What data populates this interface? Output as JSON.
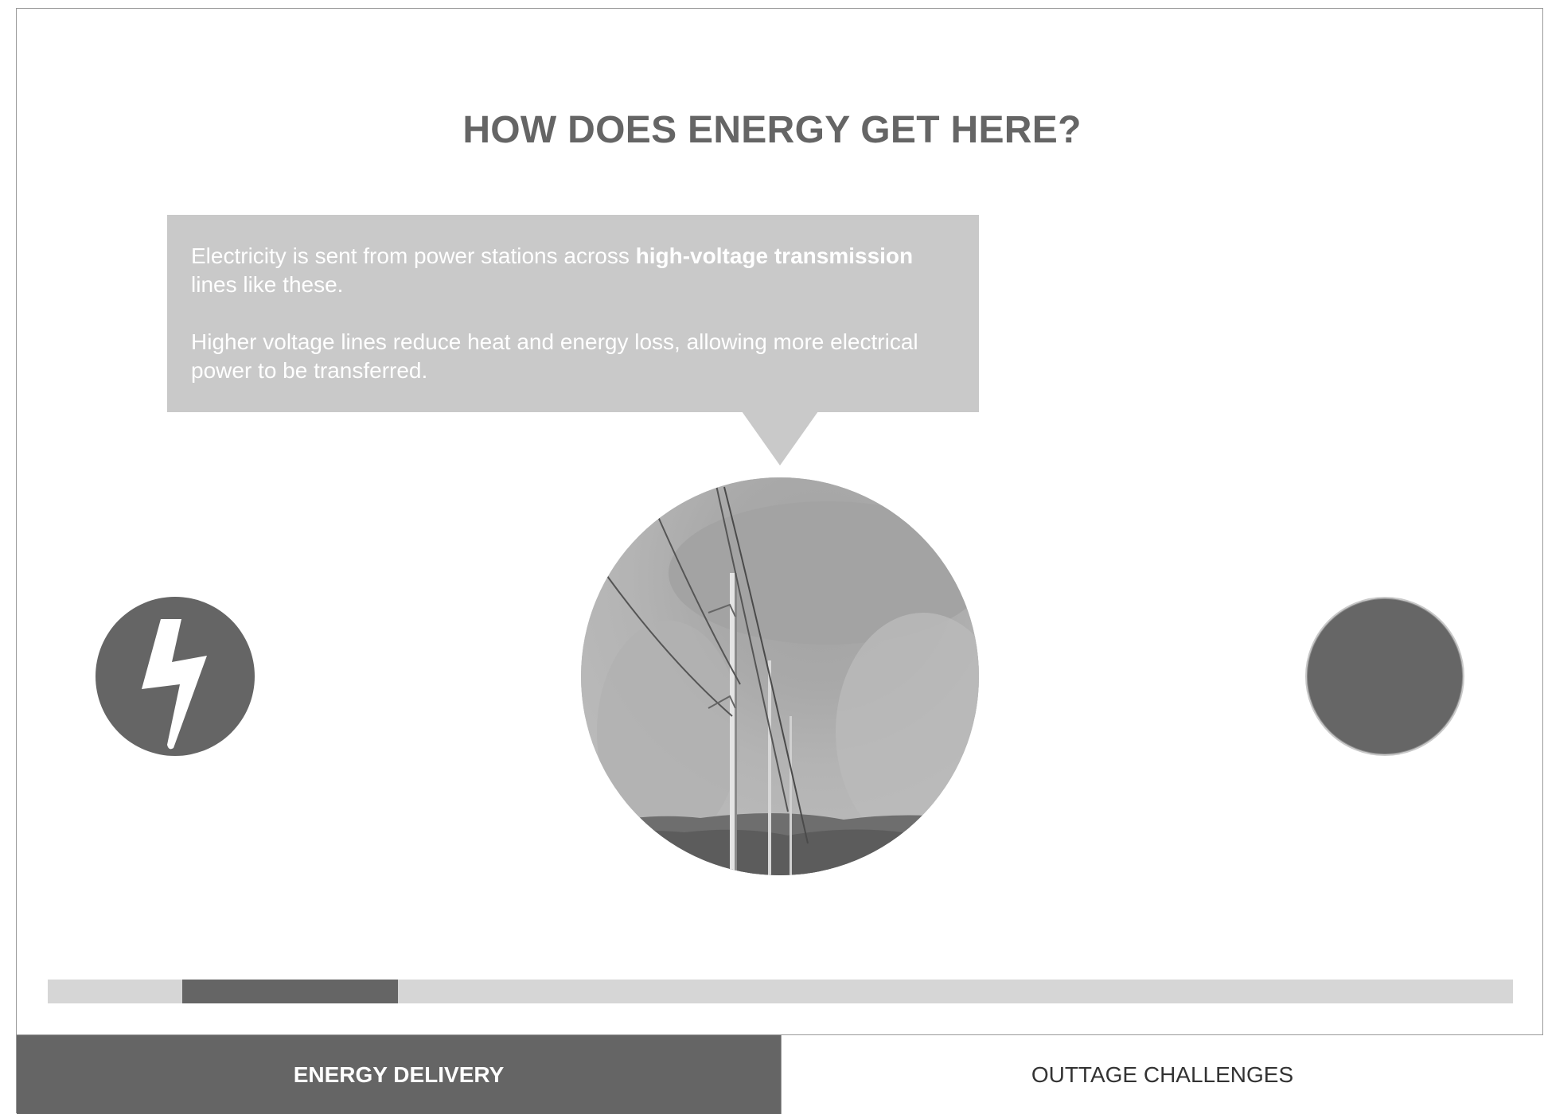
{
  "page": {
    "title": "HOW DOES ENERGY GET HERE?"
  },
  "info_box": {
    "para1_part1": "Electricity is sent from power stations across ",
    "para1_bold": "high-voltage transmission",
    "para1_part2": " lines like these.",
    "para2": "Higher voltage lines reduce heat and energy loss, allowing more electrical power to be transferred."
  },
  "icons": {
    "left_button": "lightning-icon",
    "right_button": "next-circle"
  },
  "progress": {
    "start_fraction": 0.092,
    "end_fraction": 0.239
  },
  "tabs": [
    {
      "label": "ENERGY DELIVERY",
      "active": true
    },
    {
      "label": "OUTTAGE CHALLENGES",
      "active": false
    }
  ],
  "colors": {
    "accent": "#656565",
    "panel": "#c9c9c9",
    "track": "#d6d6d6"
  }
}
